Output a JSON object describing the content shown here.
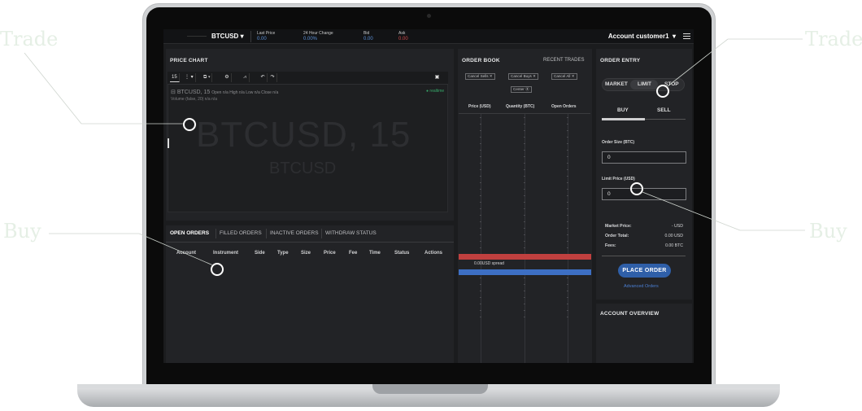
{
  "callouts": {
    "trade_left": "Trade",
    "trade_right": "Trade",
    "buy_left": "Buy",
    "buy_right": "Buy"
  },
  "topbar": {
    "symbol": "BTCUSD",
    "last_price": {
      "label": "Last Price",
      "value": "0.00"
    },
    "change_24h": {
      "label": "24 Hour Change",
      "value": "0.00%"
    },
    "bid": {
      "label": "Bid",
      "value": "0.00"
    },
    "ask": {
      "label": "Ask",
      "value": "0.00"
    },
    "account": "Account customer1"
  },
  "price_chart": {
    "title": "PRICE CHART",
    "interval": "15",
    "legend_line1": "BTCUSD, 15",
    "legend_line1_small": "Open n/a High n/a Low n/a Close n/a",
    "legend_line2": "Volume (false, 20)  n/a n/a",
    "realtime": "● realtime",
    "watermark_big": "BTCUSD, 15",
    "watermark_small": "BTCUSD"
  },
  "orders": {
    "tabs": [
      "OPEN ORDERS",
      "FILLED ORDERS",
      "INACTIVE ORDERS",
      "WITHDRAW STATUS"
    ],
    "columns": [
      "Account",
      "Instrument",
      "Side",
      "Type",
      "Size",
      "Price",
      "Fee",
      "Time",
      "Status",
      "Actions"
    ]
  },
  "order_book": {
    "title": "ORDER BOOK",
    "recent_trades": "RECENT TRADES",
    "cancel_sells": "Cancel Sells ✕",
    "cancel_buys": "Cancel Buys ✕",
    "cancel_all": "Cancel All ✕",
    "center": "Center ⦿",
    "columns": [
      "Price (USD)",
      "Quantity (BTC)",
      "Open Orders"
    ],
    "spread": "0.00USD spread",
    "dash": "-"
  },
  "order_entry": {
    "title": "ORDER ENTRY",
    "types": [
      "MARKET",
      "LIMIT",
      "STOP"
    ],
    "sides": [
      "BUY",
      "SELL"
    ],
    "order_size_label": "Order Size (BTC)",
    "order_size_value": "0",
    "limit_price_label": "Limit Price (USD)",
    "limit_price_value": "0",
    "market_price_label": "Market Price:",
    "market_price_value": "- USD",
    "order_total_label": "Order Total:",
    "order_total_value": "0.00 USD",
    "fees_label": "Fees:",
    "fees_value": "0.00 BTC",
    "place_order": "PLACE ORDER",
    "advanced_orders": "Advanced Orders"
  },
  "account_overview": {
    "title": "ACCOUNT OVERVIEW"
  },
  "colors": {
    "accent_blue": "#2f5fa8",
    "ask_red": "#c0403f",
    "bid_blue": "#3d6fc4",
    "realtime_green": "#37a86a"
  }
}
